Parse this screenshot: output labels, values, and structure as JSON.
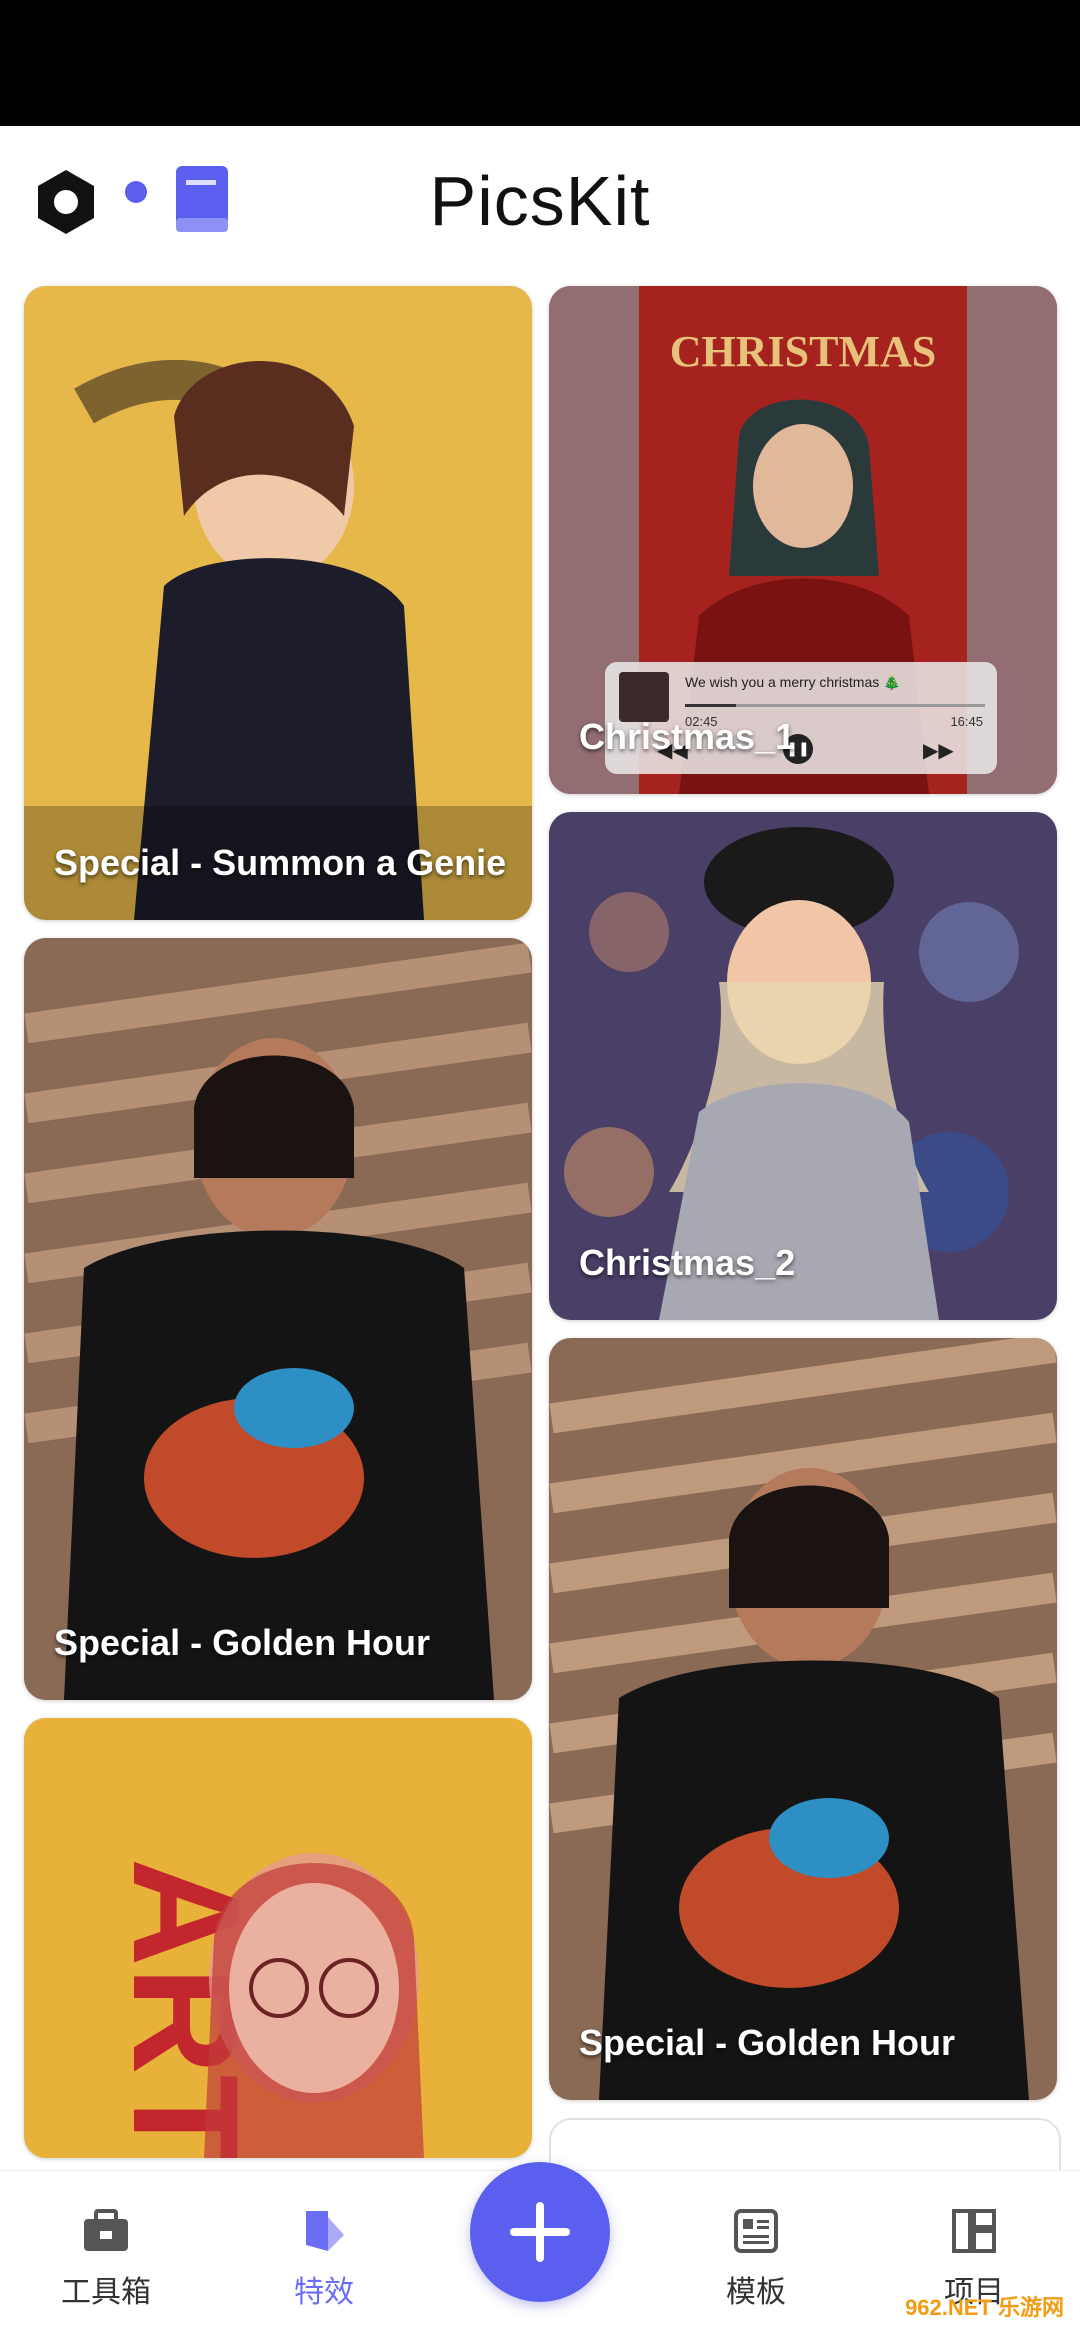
{
  "app": {
    "title": "PicsKit"
  },
  "header": {
    "settings_icon": "settings-hexagon-icon",
    "book_icon": "book-icon",
    "notify_color": "#5b5ff0"
  },
  "cards": [
    {
      "label": "Special - Summon a Genie",
      "bg": "#e6b84a"
    },
    {
      "label": "Christmas_1",
      "bg": "#a5221f"
    },
    {
      "label": "Christmas_2",
      "bg": "#4a3f67"
    },
    {
      "label": "Special - Golden Hour",
      "bg": "#8a6a55"
    },
    {
      "label": "Special - Golden Hour",
      "bg": "#8a6a55"
    },
    {
      "label": "",
      "bg": "#e8b23a"
    }
  ],
  "music_widget": {
    "title": "We wish you a merry christmas 🎄",
    "time_elapsed": "02:45",
    "time_total": "16:45",
    "progress": 0.17
  },
  "nav": {
    "tools": "工具箱",
    "effects": "特效",
    "templates": "模板",
    "projects": "项目"
  },
  "fab": {
    "icon": "plus-icon"
  },
  "colors": {
    "accent": "#5b5ff0",
    "active_tab": "#6a6ef5"
  },
  "watermark": "962.NET 乐游网"
}
